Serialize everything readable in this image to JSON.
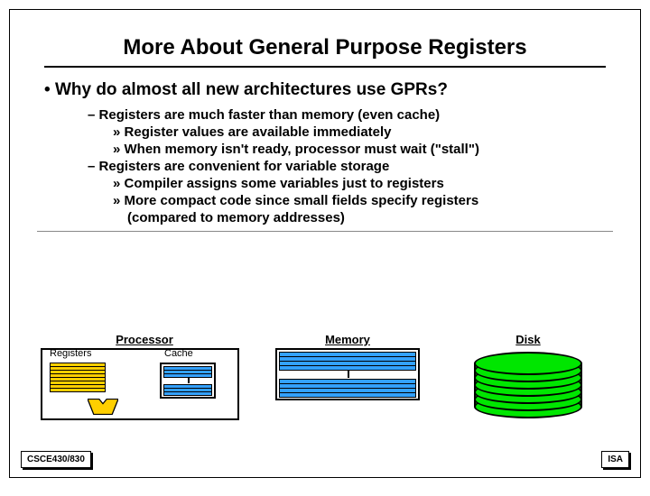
{
  "title": "More About General Purpose Registers",
  "bullets": {
    "q": "Why do almost all new architectures use GPRs?",
    "a1": "Registers are much faster than memory (even cache)",
    "a1a": "Register values are available immediately",
    "a1b": "When memory isn't ready, processor must wait (\"stall\")",
    "a2": "Registers are convenient for variable storage",
    "a2a": "Compiler assigns some variables just to registers",
    "a2b": "More compact code since small fields specify registers",
    "a2b2": "(compared to memory addresses)"
  },
  "diagram": {
    "processor": "Processor",
    "registers": "Registers",
    "cache": "Cache",
    "memory": "Memory",
    "disk": "Disk"
  },
  "footer": {
    "left": "CSCE430/830",
    "right": "ISA"
  }
}
